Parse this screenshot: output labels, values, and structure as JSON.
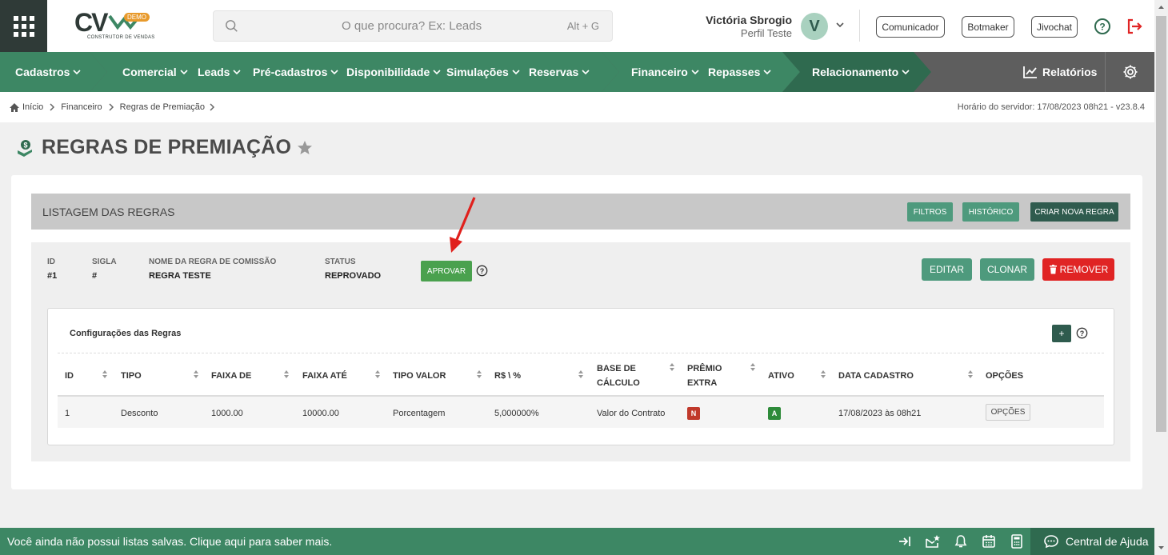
{
  "header": {
    "logo_text": "CV",
    "logo_badge": "DEMO",
    "logo_subtitle": "CONSTRUTOR DE VENDAS",
    "search_placeholder": "O que procura? Ex: Leads",
    "search_shortcut": "Alt + G",
    "user_name": "Victória Sbrogio",
    "user_profile": "Perfil Teste",
    "avatar_letter": "V",
    "buttons": [
      "Comunicador",
      "Botmaker",
      "Jivochat"
    ]
  },
  "nav": {
    "items": [
      "Cadastros",
      "Comercial",
      "Leads",
      "Pré-cadastros",
      "Disponibilidade",
      "Simulações",
      "Reservas",
      "Financeiro",
      "Repasses",
      "Relacionamento"
    ],
    "reports": "Relatórios"
  },
  "breadcrumb": {
    "items": [
      "Início",
      "Financeiro",
      "Regras de Premiação"
    ],
    "server_time": "Horário do servidor: 17/08/2023 08h21 - v23.8.4"
  },
  "page": {
    "title": "REGRAS DE PREMIAÇÃO"
  },
  "listing": {
    "title": "LISTAGEM DAS REGRAS",
    "btn_filters": "FILTROS",
    "btn_history": "HISTÓRICO",
    "btn_new": "CRIAR NOVA REGRA"
  },
  "rule": {
    "labels": {
      "id": "ID",
      "sigla": "SIGLA",
      "name": "NOME DA REGRA DE COMISSÃO",
      "status": "STATUS"
    },
    "id": "#1",
    "sigla": "#",
    "name": "REGRA TESTE",
    "status": "REPROVADO",
    "btn_approve": "APROVAR",
    "btn_edit": "EDITAR",
    "btn_clone": "CLONAR",
    "btn_remove": "REMOVER"
  },
  "config": {
    "title": "Configurações das Regras",
    "add_label": "+",
    "columns": [
      "ID",
      "TIPO",
      "FAIXA DE",
      "FAIXA ATÉ",
      "TIPO VALOR",
      "R$ \\ %",
      "BASE DE CÁLCULO",
      "PRÊMIO EXTRA",
      "ATIVO",
      "DATA CADASTRO",
      "OPÇÕES"
    ],
    "rows": [
      {
        "id": "1",
        "tipo": "Desconto",
        "faixa_de": "1000.00",
        "faixa_ate": "10000.00",
        "tipo_valor": "Porcentagem",
        "valor": "5,000000%",
        "base": "Valor do Contrato",
        "premio_extra": "N",
        "ativo": "A",
        "data": "17/08/2023 às 08h21",
        "opcoes": "OPÇÕES"
      }
    ]
  },
  "footer": {
    "message": "Você ainda não possui listas salvas. Clique aqui para saber mais.",
    "help_center": "Central de Ajuda"
  },
  "colors": {
    "nav_green": "#3d8764",
    "nav_dark_green": "#2f6a4f",
    "nav_gray": "#5e5e5e",
    "btn_teal": "#4e9a7d",
    "btn_dark": "#2f5b4e",
    "danger": "#e02424",
    "approve": "#4aa14e"
  }
}
